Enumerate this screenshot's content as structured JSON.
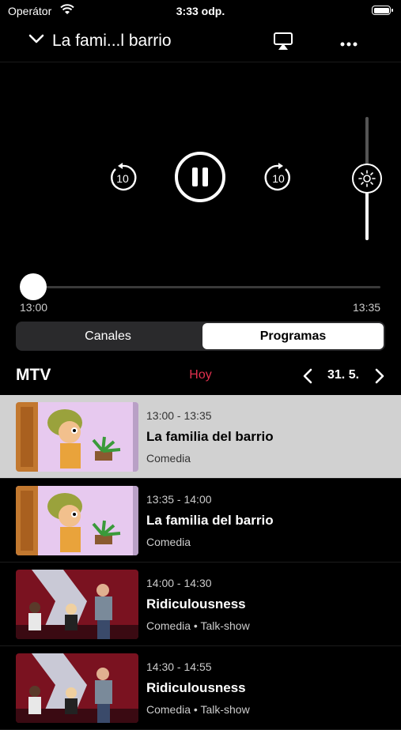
{
  "status_bar": {
    "carrier": "Operátor",
    "time": "3:33 odp."
  },
  "nav": {
    "title": "La fami...l barrio"
  },
  "player": {
    "skip_back_seconds": "10",
    "skip_forward_seconds": "10",
    "brightness_level": 0.5,
    "progress": 0.0,
    "time_start": "13:00",
    "time_end": "13:35"
  },
  "segment": {
    "canales": "Canales",
    "programas": "Programas",
    "selected": "Programas"
  },
  "guide": {
    "channel": "MTV",
    "day": "Hoy",
    "date": "31. 5."
  },
  "programs": [
    {
      "time": "13:00 - 13:35",
      "title": "La familia del barrio",
      "genre": "Comedia",
      "thumb": "cartoon",
      "selected": true
    },
    {
      "time": "13:35 - 14:00",
      "title": "La familia del barrio",
      "genre": "Comedia",
      "thumb": "cartoon",
      "selected": false
    },
    {
      "time": "14:00 - 14:30",
      "title": "Ridiculousness",
      "genre": "Comedia • Talk-show",
      "thumb": "studio",
      "selected": false
    },
    {
      "time": "14:30 - 14:55",
      "title": "Ridiculousness",
      "genre": "Comedia • Talk-show",
      "thumb": "studio",
      "selected": false
    }
  ],
  "colors": {
    "accent": "#e0304e",
    "selected_row": "#d1d1d1"
  }
}
